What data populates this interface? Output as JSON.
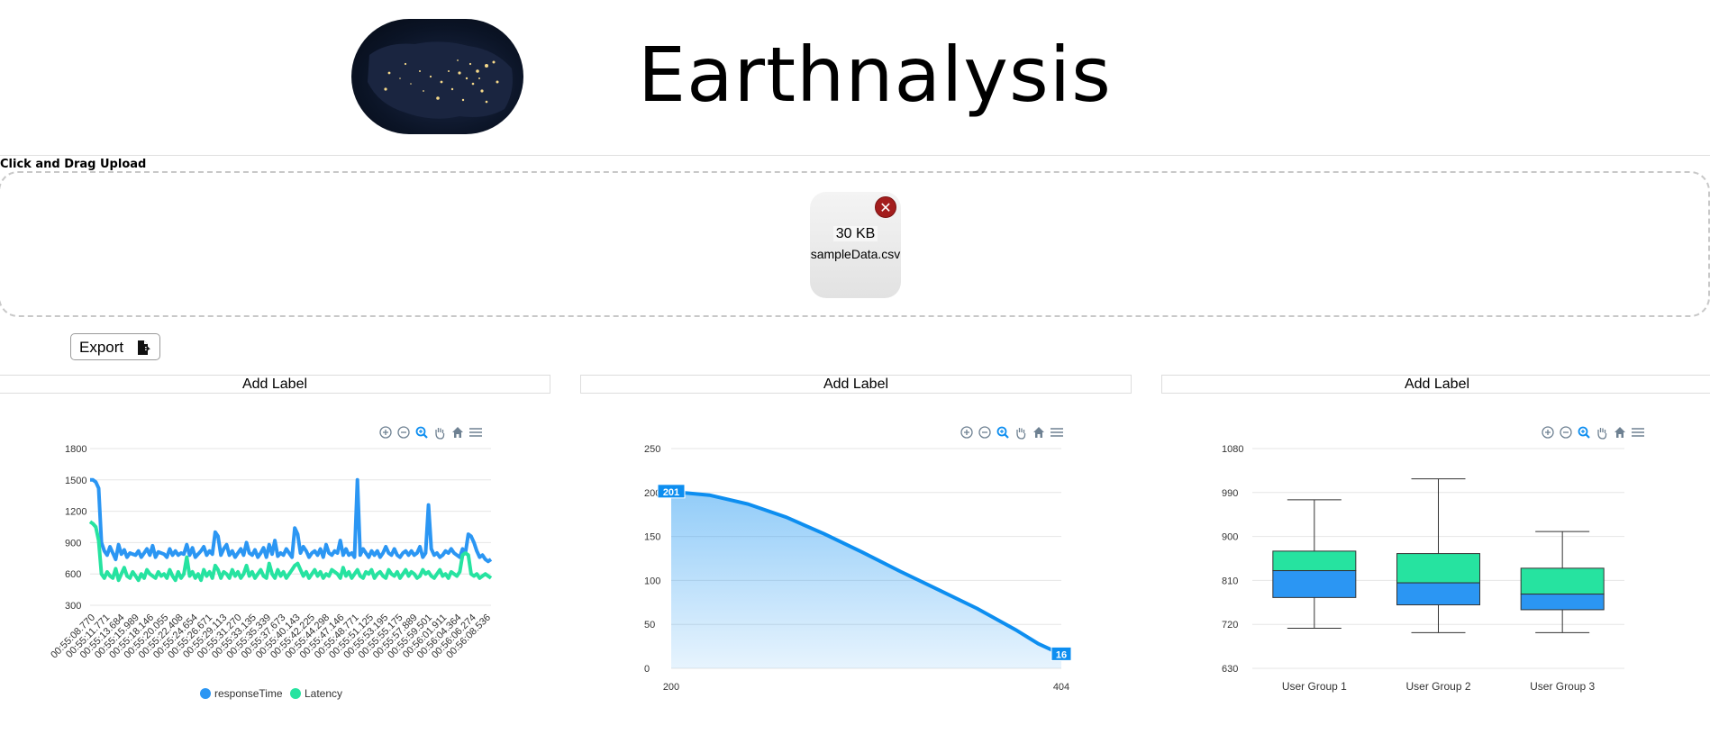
{
  "app": {
    "title": "Earthnalysis"
  },
  "upload": {
    "caption": "Click and Drag Upload",
    "file": {
      "size": "30 KB",
      "name": "sampleData.csv",
      "remove_icon": "✕"
    }
  },
  "toolbar_main": {
    "export_label": "Export"
  },
  "charts": [
    {
      "label": "Add Label"
    },
    {
      "label": "Add Label"
    },
    {
      "label": "Add Label"
    }
  ],
  "colors": {
    "blue": "#2b96f3",
    "green": "#26e3a0",
    "accent": "#0d8ef0",
    "remove": "#a31d1d",
    "toolbar_icon": "#6e8192"
  },
  "chart_data": [
    {
      "type": "line",
      "ylim": [
        300,
        1800
      ],
      "yticks": [
        300,
        600,
        900,
        1200,
        1500,
        1800
      ],
      "categories": [
        "00:55:08.770",
        "00:55:11.771",
        "00:55:13.684",
        "00:55:15.989",
        "00:55:18.146",
        "00:55:20.055",
        "00:55:22.408",
        "00:55:24.654",
        "00:55:26.671",
        "00:55:29.113",
        "00:55:31.270",
        "00:55:33.135",
        "00:55:35.339",
        "00:55:37.673",
        "00:55:40.143",
        "00:55:42.225",
        "00:55:44.298",
        "00:55:47.146",
        "00:55:48.771",
        "00:55:51.125",
        "00:55:53.195",
        "00:55:55.175",
        "00:55:57.889",
        "00:55:59.501",
        "00:56:01.911",
        "00:56:04.364",
        "00:56:06.274",
        "00:56:08.536"
      ],
      "legend_position": "bottom",
      "series": [
        {
          "name": "responseTime",
          "color": "#2b96f3",
          "values": [
            1500,
            1500,
            1480,
            1420,
            900,
            820,
            780,
            860,
            800,
            740,
            880,
            790,
            830,
            760,
            800,
            790,
            780,
            820,
            760,
            800,
            840,
            780,
            870,
            760,
            810,
            800,
            790,
            760,
            840,
            780,
            820,
            780,
            800,
            790,
            880,
            780,
            850,
            760,
            790,
            820,
            860,
            780,
            820,
            790,
            1000,
            960,
            780,
            840,
            880,
            780,
            820,
            760,
            800,
            840,
            780,
            900,
            800,
            780,
            830,
            760,
            800,
            850,
            760,
            880,
            790,
            920,
            770,
            800,
            780,
            840,
            800,
            760,
            1040,
            980,
            800,
            860,
            820,
            760,
            800,
            820,
            780,
            840,
            760,
            880,
            800,
            780,
            820,
            800,
            920,
            780,
            840,
            780,
            800,
            760,
            1500,
            780,
            840,
            800,
            760,
            820,
            780,
            820,
            760,
            800,
            860,
            800,
            780,
            840,
            780,
            760,
            800,
            820,
            780,
            820,
            780,
            800,
            860,
            760,
            800,
            1260,
            840,
            780,
            800,
            760,
            780,
            820,
            800,
            840,
            800,
            780,
            760,
            840,
            800,
            980,
            960,
            900,
            820,
            760,
            780,
            740,
            720,
            740
          ]
        },
        {
          "name": "Latency",
          "color": "#26e3a0",
          "values": [
            1100,
            1080,
            1050,
            920,
            600,
            560,
            620,
            580,
            560,
            650,
            540,
            600,
            660,
            580,
            560,
            620,
            580,
            540,
            600,
            560,
            640,
            600,
            580,
            560,
            620,
            580,
            600,
            560,
            640,
            580,
            540,
            620,
            560,
            600,
            760,
            580,
            620,
            560,
            600,
            540,
            640,
            580,
            620,
            560,
            680,
            640,
            560,
            620,
            600,
            560,
            640,
            580,
            620,
            560,
            600,
            680,
            580,
            620,
            560,
            600,
            640,
            580,
            560,
            700,
            600,
            560,
            640,
            580,
            620,
            560,
            600,
            640,
            680,
            700,
            640,
            580,
            620,
            560,
            600,
            640,
            580,
            620,
            560,
            600,
            580,
            640,
            620,
            600,
            560,
            660,
            580,
            620,
            560,
            600,
            640,
            580,
            560,
            620,
            600,
            640,
            560,
            600,
            620,
            580,
            560,
            640,
            600,
            580,
            620,
            560,
            600,
            640,
            580,
            620,
            600,
            560,
            580,
            640,
            600,
            620,
            580,
            560,
            600,
            640,
            580,
            600,
            560,
            620,
            600,
            580,
            620,
            780,
            800,
            780,
            600,
            580,
            600,
            560,
            580,
            600,
            580,
            560
          ]
        }
      ]
    },
    {
      "type": "area",
      "xlim": [
        200,
        404
      ],
      "xticks": [
        200,
        404
      ],
      "ylim": [
        0,
        250
      ],
      "yticks": [
        0,
        50,
        100,
        150,
        200,
        250
      ],
      "series": [
        {
          "color": "#0d8ef0",
          "points": [
            [
              200,
              201
            ],
            [
              220,
              197
            ],
            [
              240,
              187
            ],
            [
              260,
              172
            ],
            [
              280,
              153
            ],
            [
              300,
              132
            ],
            [
              320,
              110
            ],
            [
              340,
              89
            ],
            [
              360,
              68
            ],
            [
              380,
              44
            ],
            [
              392,
              28
            ],
            [
              404,
              16
            ]
          ]
        }
      ],
      "data_labels": [
        {
          "x": 200,
          "y": 201,
          "text": "201"
        },
        {
          "x": 404,
          "y": 16,
          "text": "16"
        }
      ]
    },
    {
      "type": "boxplot",
      "ylim": [
        630,
        1080
      ],
      "yticks": [
        630,
        720,
        810,
        900,
        990,
        1080
      ],
      "categories": [
        "User Group 1",
        "User Group 2",
        "User Group 3"
      ],
      "boxes": [
        {
          "min": 712,
          "q1": 775,
          "median": 830,
          "q3": 870,
          "max": 975
        },
        {
          "min": 703,
          "q1": 760,
          "median": 805,
          "q3": 865,
          "max": 1018
        },
        {
          "min": 703,
          "q1": 750,
          "median": 782,
          "q3": 835,
          "max": 910
        }
      ],
      "colors": {
        "lower": "#2b96f3",
        "upper": "#26e3a0"
      }
    }
  ]
}
